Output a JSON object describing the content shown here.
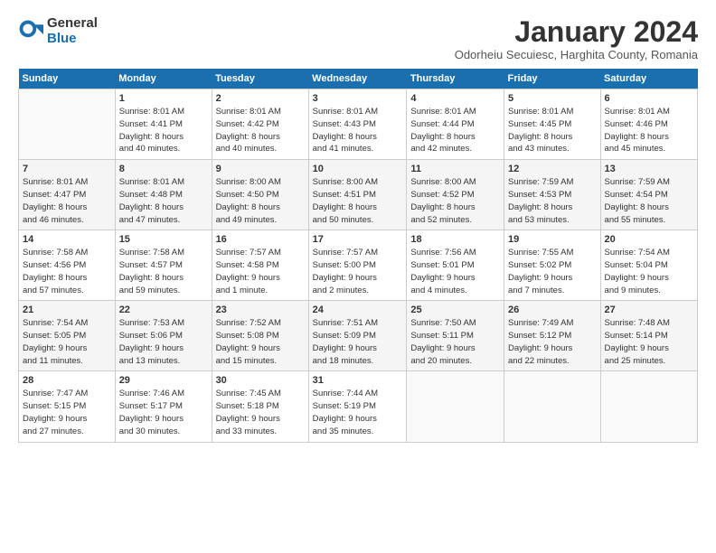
{
  "logo": {
    "general": "General",
    "blue": "Blue"
  },
  "title": "January 2024",
  "subtitle": "Odorheiu Secuiesc, Harghita County, Romania",
  "days_header": [
    "Sunday",
    "Monday",
    "Tuesday",
    "Wednesday",
    "Thursday",
    "Friday",
    "Saturday"
  ],
  "weeks": [
    [
      {
        "day": "",
        "info": ""
      },
      {
        "day": "1",
        "info": "Sunrise: 8:01 AM\nSunset: 4:41 PM\nDaylight: 8 hours\nand 40 minutes."
      },
      {
        "day": "2",
        "info": "Sunrise: 8:01 AM\nSunset: 4:42 PM\nDaylight: 8 hours\nand 40 minutes."
      },
      {
        "day": "3",
        "info": "Sunrise: 8:01 AM\nSunset: 4:43 PM\nDaylight: 8 hours\nand 41 minutes."
      },
      {
        "day": "4",
        "info": "Sunrise: 8:01 AM\nSunset: 4:44 PM\nDaylight: 8 hours\nand 42 minutes."
      },
      {
        "day": "5",
        "info": "Sunrise: 8:01 AM\nSunset: 4:45 PM\nDaylight: 8 hours\nand 43 minutes."
      },
      {
        "day": "6",
        "info": "Sunrise: 8:01 AM\nSunset: 4:46 PM\nDaylight: 8 hours\nand 45 minutes."
      }
    ],
    [
      {
        "day": "7",
        "info": "Sunrise: 8:01 AM\nSunset: 4:47 PM\nDaylight: 8 hours\nand 46 minutes."
      },
      {
        "day": "8",
        "info": "Sunrise: 8:01 AM\nSunset: 4:48 PM\nDaylight: 8 hours\nand 47 minutes."
      },
      {
        "day": "9",
        "info": "Sunrise: 8:00 AM\nSunset: 4:50 PM\nDaylight: 8 hours\nand 49 minutes."
      },
      {
        "day": "10",
        "info": "Sunrise: 8:00 AM\nSunset: 4:51 PM\nDaylight: 8 hours\nand 50 minutes."
      },
      {
        "day": "11",
        "info": "Sunrise: 8:00 AM\nSunset: 4:52 PM\nDaylight: 8 hours\nand 52 minutes."
      },
      {
        "day": "12",
        "info": "Sunrise: 7:59 AM\nSunset: 4:53 PM\nDaylight: 8 hours\nand 53 minutes."
      },
      {
        "day": "13",
        "info": "Sunrise: 7:59 AM\nSunset: 4:54 PM\nDaylight: 8 hours\nand 55 minutes."
      }
    ],
    [
      {
        "day": "14",
        "info": "Sunrise: 7:58 AM\nSunset: 4:56 PM\nDaylight: 8 hours\nand 57 minutes."
      },
      {
        "day": "15",
        "info": "Sunrise: 7:58 AM\nSunset: 4:57 PM\nDaylight: 8 hours\nand 59 minutes."
      },
      {
        "day": "16",
        "info": "Sunrise: 7:57 AM\nSunset: 4:58 PM\nDaylight: 9 hours\nand 1 minute."
      },
      {
        "day": "17",
        "info": "Sunrise: 7:57 AM\nSunset: 5:00 PM\nDaylight: 9 hours\nand 2 minutes."
      },
      {
        "day": "18",
        "info": "Sunrise: 7:56 AM\nSunset: 5:01 PM\nDaylight: 9 hours\nand 4 minutes."
      },
      {
        "day": "19",
        "info": "Sunrise: 7:55 AM\nSunset: 5:02 PM\nDaylight: 9 hours\nand 7 minutes."
      },
      {
        "day": "20",
        "info": "Sunrise: 7:54 AM\nSunset: 5:04 PM\nDaylight: 9 hours\nand 9 minutes."
      }
    ],
    [
      {
        "day": "21",
        "info": "Sunrise: 7:54 AM\nSunset: 5:05 PM\nDaylight: 9 hours\nand 11 minutes."
      },
      {
        "day": "22",
        "info": "Sunrise: 7:53 AM\nSunset: 5:06 PM\nDaylight: 9 hours\nand 13 minutes."
      },
      {
        "day": "23",
        "info": "Sunrise: 7:52 AM\nSunset: 5:08 PM\nDaylight: 9 hours\nand 15 minutes."
      },
      {
        "day": "24",
        "info": "Sunrise: 7:51 AM\nSunset: 5:09 PM\nDaylight: 9 hours\nand 18 minutes."
      },
      {
        "day": "25",
        "info": "Sunrise: 7:50 AM\nSunset: 5:11 PM\nDaylight: 9 hours\nand 20 minutes."
      },
      {
        "day": "26",
        "info": "Sunrise: 7:49 AM\nSunset: 5:12 PM\nDaylight: 9 hours\nand 22 minutes."
      },
      {
        "day": "27",
        "info": "Sunrise: 7:48 AM\nSunset: 5:14 PM\nDaylight: 9 hours\nand 25 minutes."
      }
    ],
    [
      {
        "day": "28",
        "info": "Sunrise: 7:47 AM\nSunset: 5:15 PM\nDaylight: 9 hours\nand 27 minutes."
      },
      {
        "day": "29",
        "info": "Sunrise: 7:46 AM\nSunset: 5:17 PM\nDaylight: 9 hours\nand 30 minutes."
      },
      {
        "day": "30",
        "info": "Sunrise: 7:45 AM\nSunset: 5:18 PM\nDaylight: 9 hours\nand 33 minutes."
      },
      {
        "day": "31",
        "info": "Sunrise: 7:44 AM\nSunset: 5:19 PM\nDaylight: 9 hours\nand 35 minutes."
      },
      {
        "day": "",
        "info": ""
      },
      {
        "day": "",
        "info": ""
      },
      {
        "day": "",
        "info": ""
      }
    ]
  ]
}
